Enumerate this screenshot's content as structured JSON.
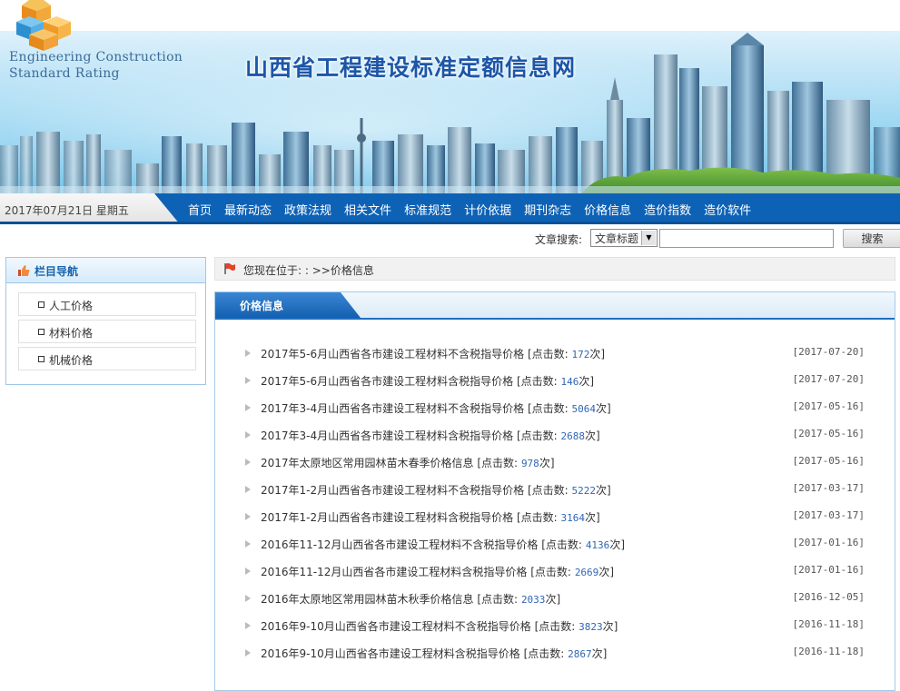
{
  "banner": {
    "logo_line1": "Engineering Construction",
    "logo_line2": "Standard Rating",
    "site_title": "山西省工程建设标准定额信息网"
  },
  "nav": {
    "date": "2017年07月21日  星期五",
    "items": [
      "首页",
      "最新动态",
      "政策法规",
      "相关文件",
      "标准规范",
      "计价依据",
      "期刊杂志",
      "价格信息",
      "造价指数",
      "造价软件"
    ]
  },
  "search": {
    "label": "文章搜索:",
    "select_value": "文章标题",
    "input_value": "",
    "button_label": "搜索"
  },
  "sidebar": {
    "title": "栏目导航",
    "items": [
      "人工价格",
      "材料价格",
      "机械价格"
    ]
  },
  "breadcrumb": {
    "text": "您现在位于: : >>价格信息"
  },
  "panel": {
    "title": "价格信息"
  },
  "articles": [
    {
      "title": "2017年5-6月山西省各市建设工程材料不含税指导价格",
      "click_prefix": "[点击数:",
      "clicks": "172",
      "click_suffix": "次]",
      "date": "[2017-07-20]"
    },
    {
      "title": "2017年5-6月山西省各市建设工程材料含税指导价格",
      "click_prefix": "[点击数:",
      "clicks": "146",
      "click_suffix": "次]",
      "date": "[2017-07-20]"
    },
    {
      "title": "2017年3-4月山西省各市建设工程材料不含税指导价格",
      "click_prefix": "[点击数:",
      "clicks": "5064",
      "click_suffix": "次]",
      "date": "[2017-05-16]"
    },
    {
      "title": "2017年3-4月山西省各市建设工程材料含税指导价格",
      "click_prefix": "[点击数:",
      "clicks": "2688",
      "click_suffix": "次]",
      "date": "[2017-05-16]"
    },
    {
      "title": "2017年太原地区常用园林苗木春季价格信息",
      "click_prefix": "[点击数:",
      "clicks": "978",
      "click_suffix": "次]",
      "date": "[2017-05-16]"
    },
    {
      "title": "2017年1-2月山西省各市建设工程材料不含税指导价格",
      "click_prefix": "[点击数:",
      "clicks": "5222",
      "click_suffix": "次]",
      "date": "[2017-03-17]"
    },
    {
      "title": "2017年1-2月山西省各市建设工程材料含税指导价格",
      "click_prefix": "[点击数:",
      "clicks": "3164",
      "click_suffix": "次]",
      "date": "[2017-03-17]"
    },
    {
      "title": "2016年11-12月山西省各市建设工程材料不含税指导价格",
      "click_prefix": "[点击数:",
      "clicks": "4136",
      "click_suffix": "次]",
      "date": "[2017-01-16]"
    },
    {
      "title": "2016年11-12月山西省各市建设工程材料含税指导价格",
      "click_prefix": "[点击数:",
      "clicks": "2669",
      "click_suffix": "次]",
      "date": "[2017-01-16]"
    },
    {
      "title": "2016年太原地区常用园林苗木秋季价格信息",
      "click_prefix": "[点击数:",
      "clicks": "2033",
      "click_suffix": "次]",
      "date": "[2016-12-05]"
    },
    {
      "title": "2016年9-10月山西省各市建设工程材料不含税指导价格",
      "click_prefix": "[点击数:",
      "clicks": "3823",
      "click_suffix": "次]",
      "date": "[2016-11-18]"
    },
    {
      "title": "2016年9-10月山西省各市建设工程材料含税指导价格",
      "click_prefix": "[点击数:",
      "clicks": "2867",
      "click_suffix": "次]",
      "date": "[2016-11-18]"
    }
  ],
  "colors": {
    "nav_blue": "#0e62b6",
    "title_blue": "#1d56a8",
    "click_blue": "#2f67b5"
  }
}
